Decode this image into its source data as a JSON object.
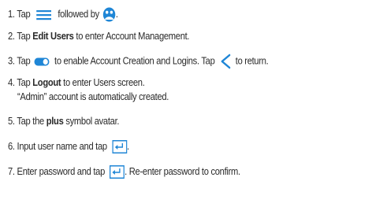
{
  "steps": [
    {
      "num": "1.",
      "a": "Tap",
      "b": "followed by",
      "c": ".",
      "icons": [
        "menu-icon",
        "users-face-icon"
      ]
    },
    {
      "num": "2.",
      "a": "Tap",
      "bold": "Edit Users",
      "b": "to enter Account Management."
    },
    {
      "num": "3.",
      "a": "Tap",
      "b": "to enable Account Creation and Logins. Tap",
      "c": "to return.",
      "icons": [
        "toggle-switch-icon",
        "chevron-left-icon"
      ]
    },
    {
      "num": "4.",
      "a": "Tap",
      "bold": "Logout",
      "b": "to enter Users screen.",
      "cont": "“Admin” account is automatically created."
    },
    {
      "num": "5.",
      "a": "Tap the",
      "bold": "plus",
      "b": "symbol avatar."
    },
    {
      "num": "6.",
      "a": "Input user name and tap",
      "b": ".",
      "icons": [
        "enter-key-icon"
      ]
    },
    {
      "num": "7.",
      "a": "Enter password and tap",
      "b": ". Re-enter password to confirm.",
      "icons": [
        "enter-key-icon"
      ]
    }
  ],
  "colors": {
    "text": "#2a2a2a",
    "accent_blue": "#1f86d6"
  }
}
